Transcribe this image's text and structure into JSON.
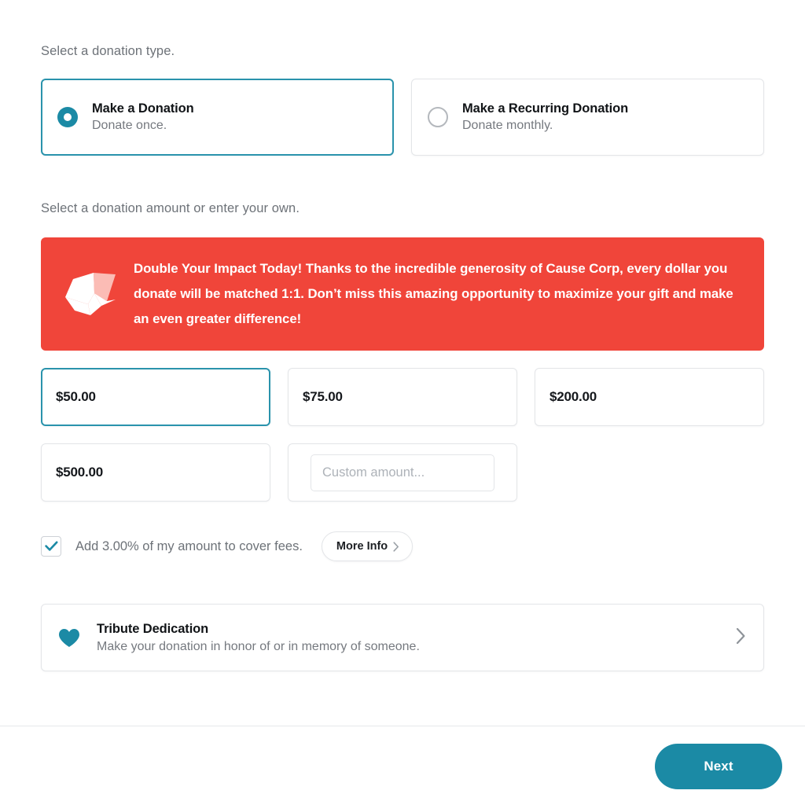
{
  "theme": {
    "accent_teal": "#1b8aa5",
    "selected_border": "#2a93ac",
    "banner_red": "#f0453a",
    "border_gray": "#e3e5e8",
    "muted_text": "#6d7278"
  },
  "donation_type": {
    "label": "Select a donation type.",
    "options": [
      {
        "title": "Make a Donation",
        "subtitle": "Donate once.",
        "selected": true
      },
      {
        "title": "Make a Recurring Donation",
        "subtitle": "Donate monthly.",
        "selected": false
      }
    ]
  },
  "donation_amount": {
    "label": "Select a donation amount or enter your own.",
    "banner": {
      "icon": "origami-crane-icon",
      "text": "Double Your Impact Today! Thanks to the incredible generosity of Cause Corp, every dollar you donate will be matched 1:1. Don’t miss this amazing opportunity to maximize your gift and make an even greater difference!"
    },
    "presets": [
      {
        "label": "$50.00",
        "selected": true
      },
      {
        "label": "$75.00",
        "selected": false
      },
      {
        "label": "$200.00",
        "selected": false
      },
      {
        "label": "$500.00",
        "selected": false
      }
    ],
    "custom": {
      "placeholder": "Custom amount...",
      "value": ""
    }
  },
  "fees": {
    "checked": true,
    "label": "Add 3.00% of my amount to cover fees.",
    "more_info_label": "More Info",
    "more_info_icon": "chevron-right-icon"
  },
  "tribute": {
    "icon": "heart-icon",
    "title": "Tribute Dedication",
    "subtitle": "Make your donation in honor of or in memory of someone.",
    "chevron_icon": "chevron-right-icon"
  },
  "footer": {
    "next_label": "Next"
  }
}
